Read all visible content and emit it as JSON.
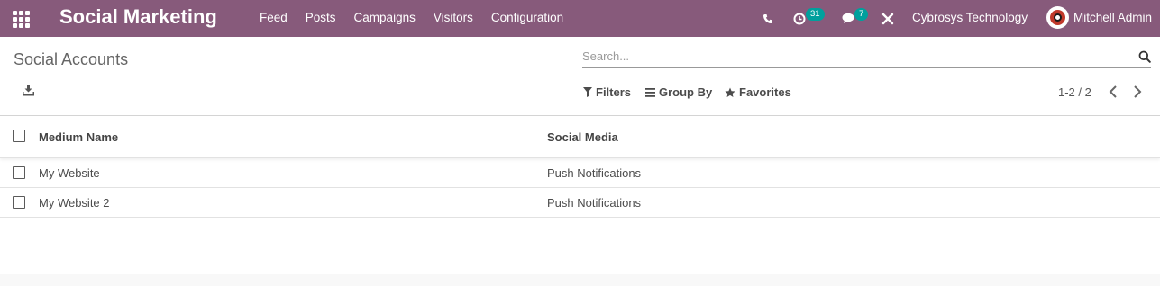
{
  "navbar": {
    "app_title": "Social Marketing",
    "menu": [
      "Feed",
      "Posts",
      "Campaigns",
      "Visitors",
      "Configuration"
    ],
    "activity_count": "31",
    "message_count": "7",
    "company": "Cybrosys Technology",
    "user": "Mitchell Admin",
    "color": "#875a7b",
    "badge_color": "#00a09d"
  },
  "control_panel": {
    "title": "Social Accounts",
    "search_placeholder": "Search...",
    "filters_label": "Filters",
    "group_by_label": "Group By",
    "favorites_label": "Favorites",
    "pager": "1-2 / 2"
  },
  "table": {
    "columns": [
      "Medium Name",
      "Social Media"
    ],
    "rows": [
      [
        "My Website",
        "Push Notifications"
      ],
      [
        "My Website 2",
        "Push Notifications"
      ]
    ]
  },
  "icons": [
    "apps-icon",
    "phone-icon",
    "activity-icon",
    "chat-icon",
    "debug-icon",
    "search-icon",
    "download-icon",
    "filter-icon",
    "group-by-icon",
    "star-icon",
    "chevron-left-icon",
    "chevron-right-icon"
  ]
}
